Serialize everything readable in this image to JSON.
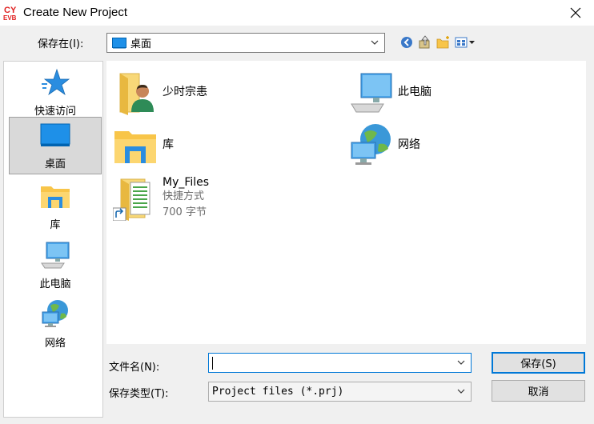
{
  "window": {
    "title": "Create New Project"
  },
  "lookin": {
    "label": "保存在(I):",
    "value": "桌面"
  },
  "places": [
    {
      "label": "快速访问",
      "icon": "star-icon"
    },
    {
      "label": "桌面",
      "icon": "desktop-icon",
      "selected": true
    },
    {
      "label": "库",
      "icon": "library-folder-icon"
    },
    {
      "label": "此电脑",
      "icon": "computer-icon"
    },
    {
      "label": "网络",
      "icon": "network-icon"
    }
  ],
  "files": [
    {
      "name": "少时宗恚",
      "icon": "user-folder-icon"
    },
    {
      "name": "此电脑",
      "icon": "computer-icon"
    },
    {
      "name": "库",
      "icon": "library-folder-icon"
    },
    {
      "name": "网络",
      "icon": "network-icon"
    },
    {
      "name": "My_Files",
      "type": "快捷方式",
      "size": "700 字节",
      "icon": "shortcut-folder-icon"
    }
  ],
  "filename": {
    "label": "文件名(N):",
    "value": ""
  },
  "filetype": {
    "label": "保存类型(T):",
    "value": "Project files (*.prj)"
  },
  "buttons": {
    "save": "保存(S)",
    "cancel": "取消"
  },
  "colors": {
    "accent": "#0078d7",
    "folder": "#f8c549",
    "logo": "#e02020"
  }
}
